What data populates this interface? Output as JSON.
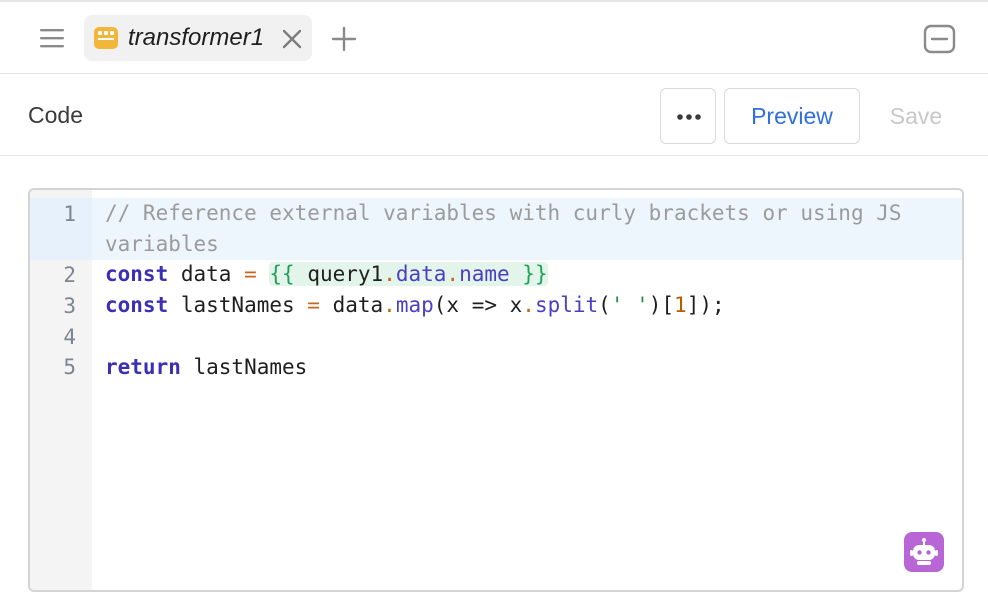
{
  "tabs": [
    {
      "label": "transformer1",
      "active": true,
      "icon": "transformer-icon",
      "icon_color": "#f2b63a"
    }
  ],
  "toolbar": {
    "title": "Code",
    "more_icon": "ellipsis-icon",
    "preview_label": "Preview",
    "save_label": "Save"
  },
  "editor": {
    "line_numbers": [
      "1",
      "2",
      "3",
      "4",
      "5"
    ],
    "lines": {
      "l1a": "// Reference external variables with curly brackets or using JS",
      "l1b": "variables",
      "l2_kw": "const",
      "l2_name": " data ",
      "l2_eq": "=",
      "l2_open": "{{ ",
      "l2_obj": "query1",
      "l2_dot1": ".",
      "l2_p1": "data",
      "l2_dot2": ".",
      "l2_p2": "name",
      "l2_close": " }}",
      "l3_kw": "const",
      "l3_name": " lastNames ",
      "l3_eq": "=",
      "l3_a": " data",
      "l3_dot1": ".",
      "l3_map": "map",
      "l3_b": "(x => x",
      "l3_dot2": ".",
      "l3_split": "split",
      "l3_c": "(",
      "l3_str": "' '",
      "l3_d": ")[",
      "l3_num": "1",
      "l3_e": "]);",
      "l5_kw": "return",
      "l5_rest": " lastNames"
    }
  },
  "colors": {
    "accent": "#2f6fe0",
    "assistant": "#b865d6"
  },
  "icons": [
    "menu-icon",
    "transformer-icon",
    "close-icon",
    "plus-icon",
    "collapse-panel-icon",
    "ellipsis-icon",
    "assistant-bot-icon"
  ]
}
